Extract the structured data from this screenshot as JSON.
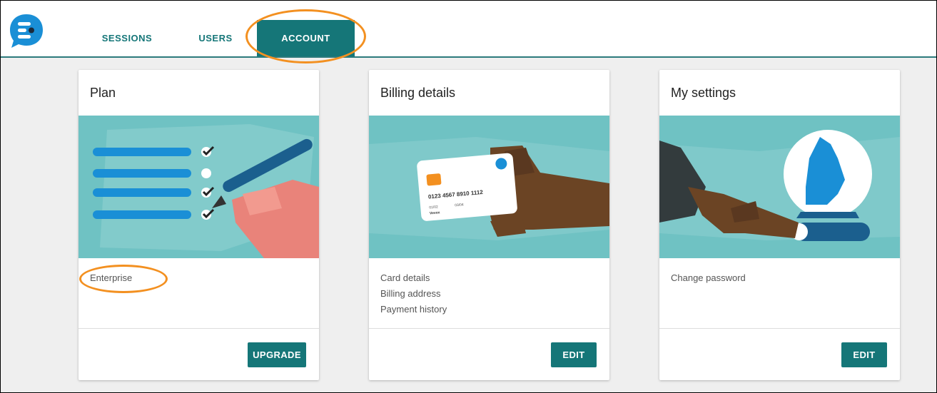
{
  "nav": {
    "tabs": [
      {
        "label": "SESSIONS",
        "active": false
      },
      {
        "label": "USERS",
        "active": false
      },
      {
        "label": "ACCOUNT",
        "active": true
      }
    ]
  },
  "colors": {
    "brand_teal": "#157678",
    "illustration_bg": "#6fc2c3",
    "highlight_orange": "#f39020",
    "logo_blue": "#1a8fd6"
  },
  "cards": [
    {
      "title": "Plan",
      "lines": [
        "Enterprise"
      ],
      "button": "UPGRADE",
      "illustration": "checklist-hand-pen"
    },
    {
      "title": "Billing details",
      "lines": [
        "Card details",
        "Billing address",
        "Payment history"
      ],
      "button": "EDIT",
      "illustration": "hand-holding-card",
      "card_art": {
        "number": "0123 4567 8910 1112",
        "valid_from": "01/02",
        "valid_to": "03/04",
        "name": "Vevox"
      }
    },
    {
      "title": "My settings",
      "lines": [
        "Change password"
      ],
      "button": "EDIT",
      "illustration": "finger-toggle-avatar"
    }
  ]
}
